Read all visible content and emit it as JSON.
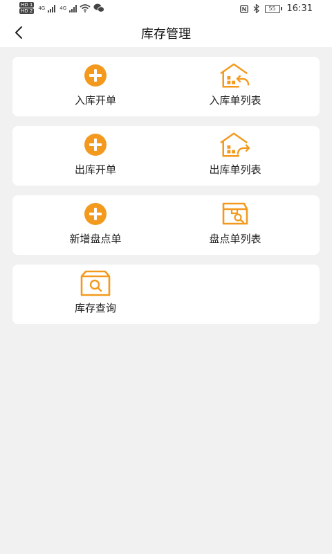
{
  "status_bar": {
    "hd1": "HD 1",
    "hd2": "HD 2",
    "net1": "4G",
    "net2": "4G",
    "battery": "55",
    "time": "16:31"
  },
  "header": {
    "title": "库存管理"
  },
  "sections": [
    {
      "items": [
        {
          "label": "入库开单",
          "icon": "plus-circle-icon"
        },
        {
          "label": "入库单列表",
          "icon": "warehouse-return-icon"
        }
      ]
    },
    {
      "items": [
        {
          "label": "出库开单",
          "icon": "plus-circle-icon"
        },
        {
          "label": "出库单列表",
          "icon": "warehouse-forward-icon"
        }
      ]
    },
    {
      "items": [
        {
          "label": "新增盘点单",
          "icon": "plus-circle-icon"
        },
        {
          "label": "盘点单列表",
          "icon": "box-search-icon"
        }
      ]
    },
    {
      "items": [
        {
          "label": "库存查询",
          "icon": "package-search-icon"
        }
      ]
    }
  ],
  "colors": {
    "accent": "#f39a1e",
    "background": "#f1f1f1",
    "card": "#ffffff"
  }
}
